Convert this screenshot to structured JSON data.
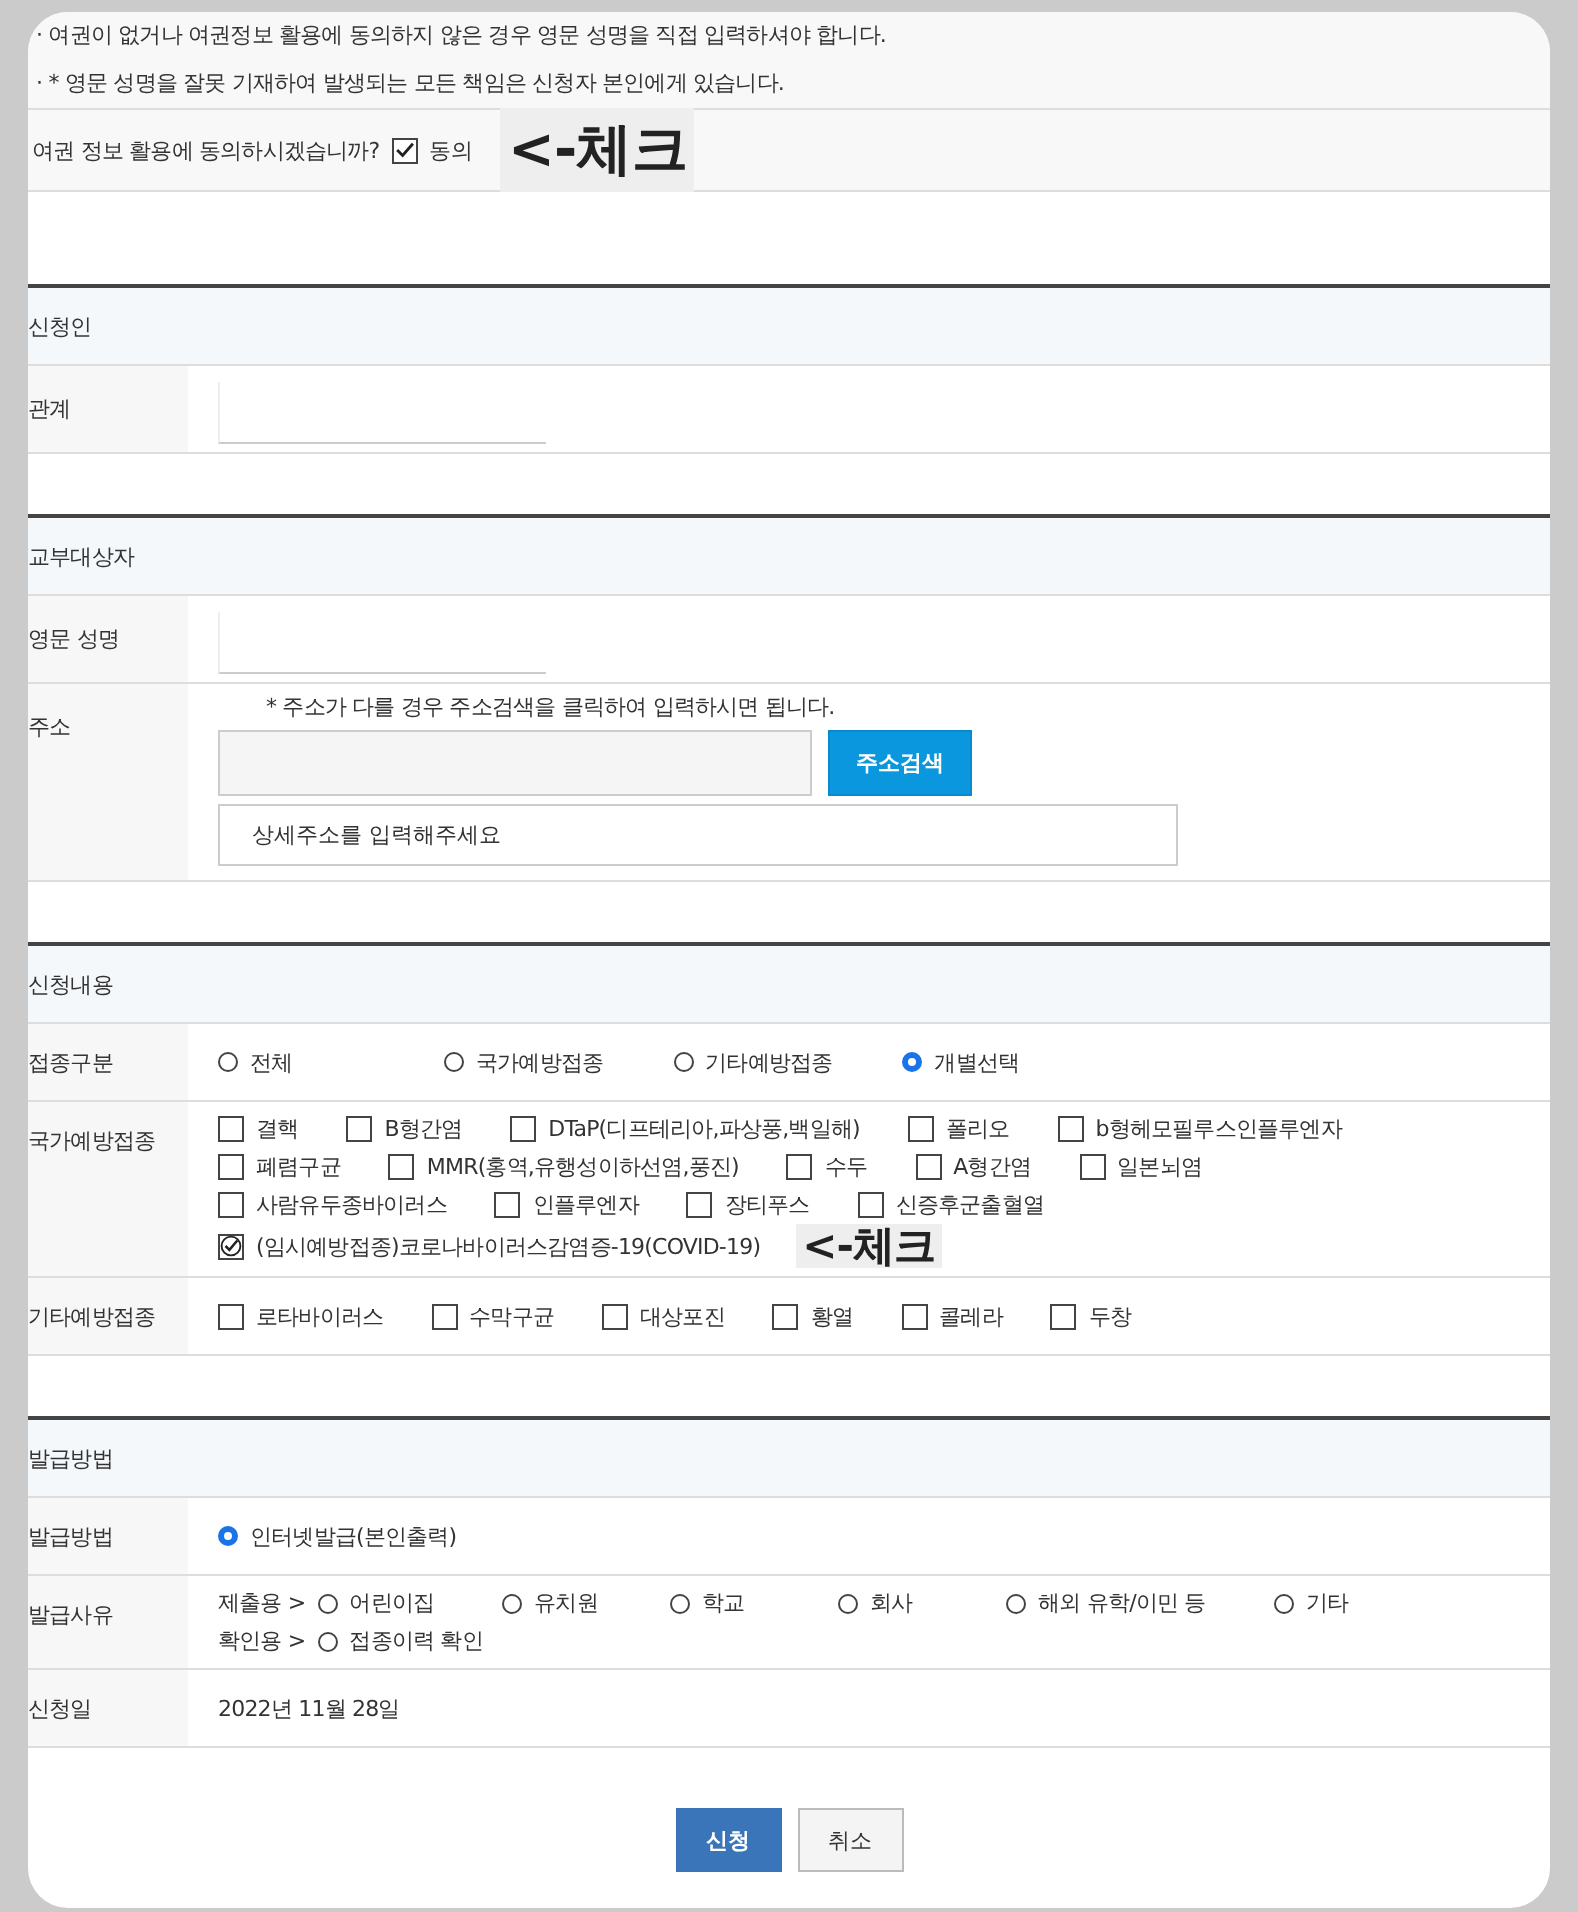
{
  "notices": [
    "· 여권이 없거나 여권정보 활용에 동의하지 않은 경우 영문 성명을 직접 입력하셔야 합니다.",
    "· * 영문 성명을 잘못 기재하여 발생되는 모든 책임은 신청자 본인에게 있습니다."
  ],
  "consent": {
    "question": "여권 정보 활용에 동의하시겠습니까?",
    "label": "동의",
    "checked": true,
    "annotation": "<-체크"
  },
  "sections": [
    {
      "title": "신청인",
      "rows": [
        {
          "kind": "blank",
          "label": "관계"
        }
      ]
    },
    {
      "title": "교부대상자",
      "rows": [
        {
          "kind": "blank",
          "label": "영문 성명"
        },
        {
          "kind": "address",
          "label": "주소",
          "note": "* 주소가 다를 경우 주소검색을 클릭하여 입력하시면 됩니다.",
          "button": "주소검색",
          "placeholder": "상세주소를 입력해주세요"
        }
      ]
    },
    {
      "title": "신청내용",
      "rows": [
        {
          "kind": "radios",
          "label": "접종구분",
          "options": [
            {
              "label": "전체",
              "selected": false
            },
            {
              "label": "국가예방접종",
              "selected": false
            },
            {
              "label": "기타예방접종",
              "selected": false
            },
            {
              "label": "개별선택",
              "selected": true
            }
          ]
        },
        {
          "kind": "checks",
          "label": "국가예방접종",
          "lines": [
            [
              {
                "label": "결핵",
                "checked": false
              },
              {
                "label": "B형간염",
                "checked": false
              },
              {
                "label": "DTaP(디프테리아,파상풍,백일해)",
                "checked": false
              },
              {
                "label": "폴리오",
                "checked": false
              },
              {
                "label": "b형헤모필루스인플루엔자",
                "checked": false
              }
            ],
            [
              {
                "label": "폐렴구균",
                "checked": false
              },
              {
                "label": "MMR(홍역,유행성이하선염,풍진)",
                "checked": false
              },
              {
                "label": "수두",
                "checked": false
              },
              {
                "label": "A형간염",
                "checked": false
              },
              {
                "label": "일본뇌염",
                "checked": false
              }
            ],
            [
              {
                "label": "사람유두종바이러스",
                "checked": false
              },
              {
                "label": "인플루엔자",
                "checked": false
              },
              {
                "label": "장티푸스",
                "checked": false
              },
              {
                "label": "신증후군출혈열",
                "checked": false
              }
            ],
            [
              {
                "label": "(임시예방접종)코로나바이러스감염증-19(COVID-19)",
                "checked": true,
                "annotation": "<-체크"
              }
            ]
          ]
        },
        {
          "kind": "checks",
          "label": "기타예방접종",
          "lines": [
            [
              {
                "label": "로타바이러스",
                "checked": false
              },
              {
                "label": "수막구균",
                "checked": false
              },
              {
                "label": "대상포진",
                "checked": false
              },
              {
                "label": "황열",
                "checked": false
              },
              {
                "label": "콜레라",
                "checked": false
              },
              {
                "label": "두창",
                "checked": false
              }
            ]
          ]
        }
      ]
    },
    {
      "title": "발급방법",
      "rows": [
        {
          "kind": "radios",
          "label": "발급방법",
          "options": [
            {
              "label": "인터넷발급(본인출력)",
              "selected": true
            }
          ]
        },
        {
          "kind": "groups",
          "label": "발급사유",
          "groups": [
            {
              "prefix": "제출용 >",
              "options": [
                {
                  "label": "어린이집",
                  "selected": false
                },
                {
                  "label": "유치원",
                  "selected": false
                },
                {
                  "label": "학교",
                  "selected": false
                },
                {
                  "label": "회사",
                  "selected": false
                },
                {
                  "label": "해외 유학/이민 등",
                  "selected": false
                },
                {
                  "label": "기타",
                  "selected": false
                }
              ]
            },
            {
              "prefix": "확인용 >",
              "options": [
                {
                  "label": "접종이력 확인",
                  "selected": false
                }
              ]
            }
          ]
        },
        {
          "kind": "text",
          "label": "신청일",
          "value": "2022년 11월 28일"
        }
      ]
    }
  ],
  "buttons": [
    {
      "label": "신청",
      "kind": "primary"
    },
    {
      "label": "취소",
      "kind": "secondary"
    }
  ]
}
